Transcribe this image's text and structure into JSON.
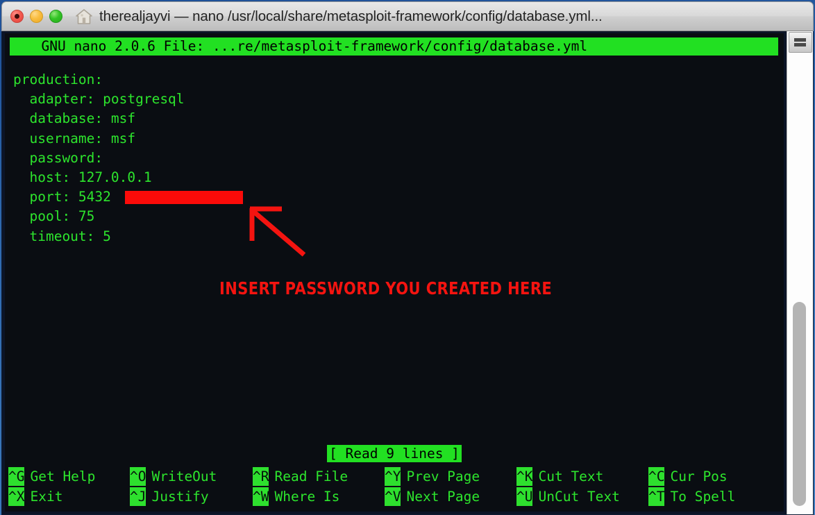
{
  "window": {
    "title": "therealjayvi — nano /usr/local/share/metasploit-framework/config/database.yml...",
    "home_icon": "home-icon",
    "controls": {
      "close": "close-button",
      "minimize": "minimize-button",
      "maximize": "maximize-button"
    }
  },
  "nano": {
    "header": "  GNU nano 2.0.6 File: ...re/metasploit-framework/config/database.yml",
    "content": "production:\n  adapter: postgresql\n  database: msf\n  username: msf\n  password: \n  host: 127.0.0.1\n  port: 5432\n  pool: 75\n  timeout: 5",
    "status": "[ Read 9 lines ]",
    "help": [
      [
        {
          "key": "^G",
          "label": "Get Help"
        },
        {
          "key": "^O",
          "label": "WriteOut"
        },
        {
          "key": "^R",
          "label": "Read File"
        },
        {
          "key": "^Y",
          "label": "Prev Page"
        },
        {
          "key": "^K",
          "label": "Cut Text"
        },
        {
          "key": "^C",
          "label": "Cur Pos"
        }
      ],
      [
        {
          "key": "^X",
          "label": "Exit"
        },
        {
          "key": "^J",
          "label": "Justify"
        },
        {
          "key": "^W",
          "label": "Where Is"
        },
        {
          "key": "^V",
          "label": "Next Page"
        },
        {
          "key": "^U",
          "label": "UnCut Text"
        },
        {
          "key": "^T",
          "label": "To Spell"
        }
      ]
    ]
  },
  "annotation": {
    "caption": "INSERT PASSWORD YOU CREATED HERE",
    "arrow": "arrow-pointing-up-left",
    "redaction": "password-value-redaction-block",
    "color": "#f41410"
  },
  "scrollbar": {
    "pane_button": "split-pane-button",
    "thumb": "scroll-thumb"
  },
  "colors": {
    "terminal_bg": "#0a0d12",
    "terminal_green": "#2de52d",
    "highlight_green": "#22e022",
    "annotation_red": "#f41410"
  }
}
